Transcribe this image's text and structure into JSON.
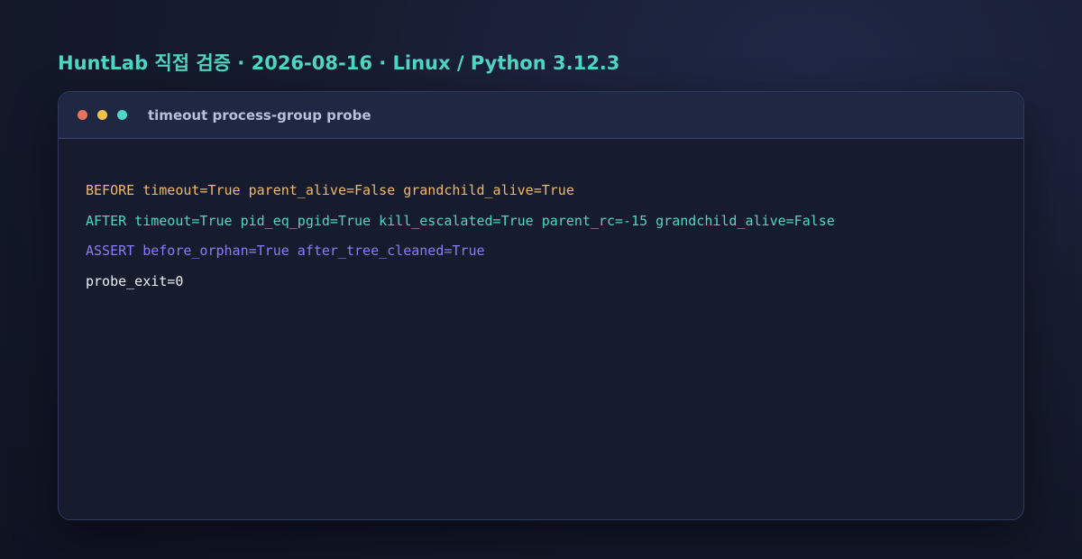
{
  "header": {
    "title": "HuntLab 직접 검증 · 2026-08-16 · Linux / Python 3.12.3"
  },
  "window": {
    "title": "timeout process-group probe",
    "buttons": [
      {
        "name": "close",
        "color": "#e8735f"
      },
      {
        "name": "minimize",
        "color": "#f2c14e"
      },
      {
        "name": "maximize",
        "color": "#4fd6c4"
      }
    ]
  },
  "terminal": {
    "lines": [
      {
        "text": "BEFORE timeout=True parent_alive=False grandchild_alive=True",
        "color": "#f2b86a"
      },
      {
        "text": "AFTER timeout=True pid_eq_pgid=True kill_escalated=True parent_rc=-15 grandchild_alive=False",
        "color": "#4fd6c4"
      },
      {
        "text": "ASSERT before_orphan=True after_tree_cleaned=True",
        "color": "#8b7cf6"
      },
      {
        "text": "probe_exit=0",
        "color": "#eef1f8"
      }
    ]
  }
}
